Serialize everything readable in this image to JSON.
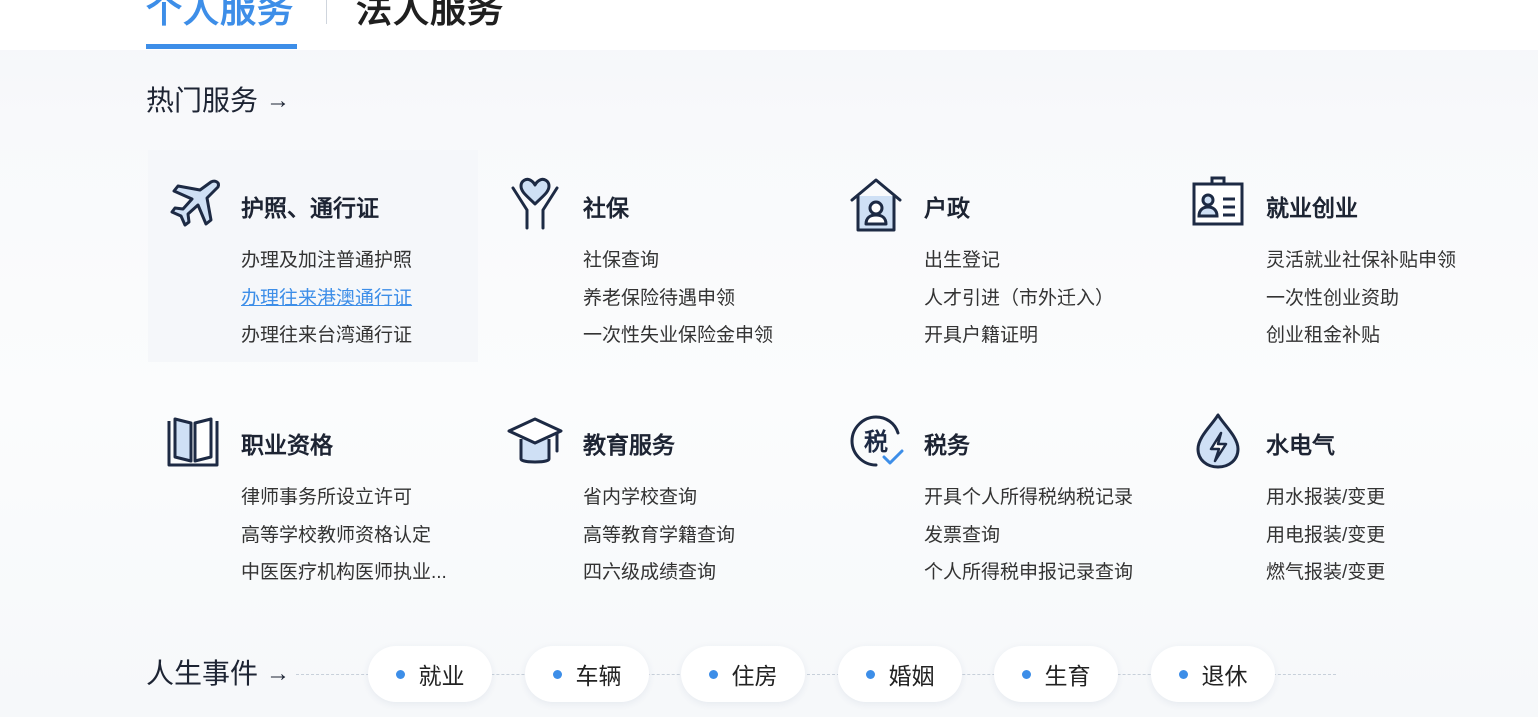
{
  "tabs": {
    "personal": "个人服务",
    "legal": "法人服务"
  },
  "hot_services": {
    "heading": "热门服务",
    "arrow": "→"
  },
  "services": [
    {
      "icon": "airplane-icon",
      "title": "护照、通行证",
      "links": [
        "办理及加注普通护照",
        "办理往来港澳通行证",
        "办理往来台湾通行证"
      ],
      "active_index": 1
    },
    {
      "icon": "heart-hands-icon",
      "title": "社保",
      "links": [
        "社保查询",
        "养老保险待遇申领",
        "一次性失业保险金申领"
      ]
    },
    {
      "icon": "house-person-icon",
      "title": "户政",
      "links": [
        "出生登记",
        "人才引进（市外迁入）",
        "开具户籍证明"
      ]
    },
    {
      "icon": "id-badge-icon",
      "title": "就业创业",
      "links": [
        "灵活就业社保补贴申领",
        "一次性创业资助",
        "创业租金补贴"
      ]
    },
    {
      "icon": "open-book-icon",
      "title": "职业资格",
      "links": [
        "律师事务所设立许可",
        "高等学校教师资格认定",
        "中医医疗机构医师执业..."
      ]
    },
    {
      "icon": "graduation-cap-icon",
      "title": "教育服务",
      "links": [
        "省内学校查询",
        "高等教育学籍查询",
        "四六级成绩查询"
      ]
    },
    {
      "icon": "tax-icon",
      "icon_text": "税",
      "title": "税务",
      "links": [
        "开具个人所得税纳税记录",
        "发票查询",
        "个人所得税申报记录查询"
      ]
    },
    {
      "icon": "water-drop-bolt-icon",
      "title": "水电气",
      "links": [
        "用水报装/变更",
        "用电报装/变更",
        "燃气报装/变更"
      ]
    }
  ],
  "life_events": {
    "heading": "人生事件",
    "arrow": "→",
    "items": [
      "就业",
      "车辆",
      "住房",
      "婚姻",
      "生育",
      "退休"
    ]
  },
  "colors": {
    "accent": "#3d8ee8",
    "icon_stroke": "#1d2a44",
    "icon_fill": "#cfe0f5"
  }
}
